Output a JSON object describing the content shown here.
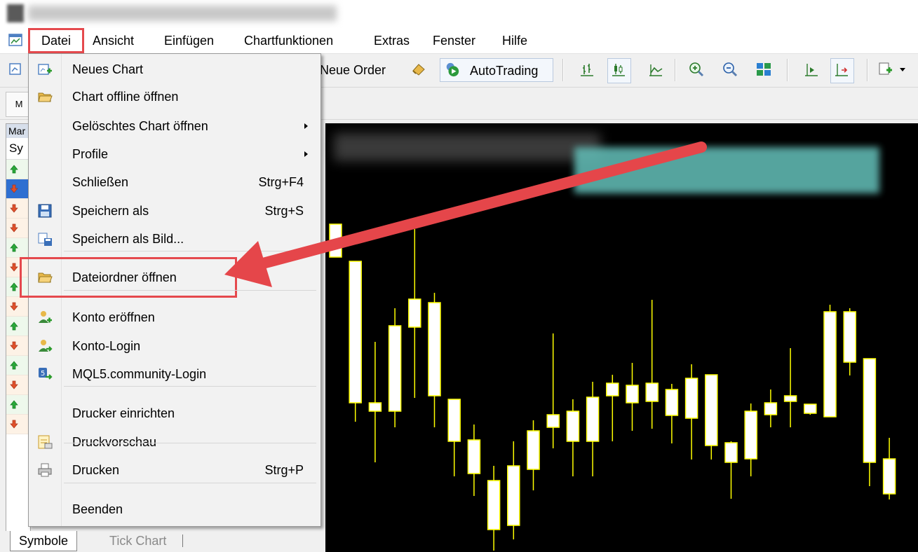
{
  "menubar": {
    "items": [
      "Datei",
      "Ansicht",
      "Einfügen",
      "Chartfunktionen",
      "Extras",
      "Fenster",
      "Hilfe"
    ]
  },
  "toolbar": {
    "neue_order": "Neue Order",
    "autotrading": "AutoTrading"
  },
  "toolbar2": {
    "button": "M"
  },
  "leftpanel": {
    "header": "Mar",
    "column": "Sy",
    "rows": [
      "up",
      "down-selected",
      "down",
      "down",
      "up",
      "down",
      "up",
      "down",
      "up",
      "down",
      "up",
      "down",
      "up",
      "down"
    ]
  },
  "file_menu": {
    "items": [
      {
        "label": "Neues Chart",
        "shortcut": "",
        "icon": "new-chart-icon"
      },
      {
        "label": "Chart offline öffnen",
        "shortcut": "",
        "icon": "open-folder-icon"
      },
      {
        "label": "Gelöschtes Chart öffnen",
        "shortcut": "",
        "icon": "",
        "submenu": true
      },
      {
        "label": "Profile",
        "shortcut": "",
        "icon": "",
        "submenu": true
      },
      {
        "label": "Schließen",
        "shortcut": "Strg+F4",
        "icon": ""
      },
      {
        "label": "Speichern als",
        "shortcut": "Strg+S",
        "icon": "floppy-disk-icon"
      },
      {
        "label": "Speichern als Bild...",
        "shortcut": "",
        "icon": "save-image-icon"
      },
      {
        "label": "Dateiordner öffnen",
        "shortcut": "",
        "icon": "folder-icon",
        "highlighted": true
      },
      {
        "label": "Konto eröffnen",
        "shortcut": "",
        "icon": "add-account-icon"
      },
      {
        "label": "Konto-Login",
        "shortcut": "",
        "icon": "account-login-icon"
      },
      {
        "label": "MQL5.community-Login",
        "shortcut": "",
        "icon": "mql5-login-icon"
      },
      {
        "label": "Drucker einrichten",
        "shortcut": "",
        "icon": ""
      },
      {
        "label": "Druckvorschau",
        "shortcut": "",
        "icon": "print-preview-icon"
      },
      {
        "label": "Drucken",
        "shortcut": "Strg+P",
        "icon": "printer-icon"
      },
      {
        "label": "Beenden",
        "shortcut": "",
        "icon": ""
      }
    ]
  },
  "bottom_tabs": [
    "Symbole",
    "Tick Chart"
  ],
  "chart": {
    "background": "#000000",
    "candle_color": "#ffff00",
    "candles": [
      {
        "o": 320,
        "c": 367,
        "h": 320,
        "l": 367
      },
      {
        "o": 373,
        "c": 575,
        "h": 373,
        "l": 602
      },
      {
        "o": 575,
        "c": 587,
        "h": 488,
        "l": 660
      },
      {
        "o": 465,
        "c": 587,
        "h": 440,
        "l": 610
      },
      {
        "o": 427,
        "c": 467,
        "h": 327,
        "l": 568
      },
      {
        "o": 432,
        "c": 565,
        "h": 418,
        "l": 610
      },
      {
        "o": 570,
        "c": 630,
        "h": 570,
        "l": 680
      },
      {
        "o": 628,
        "c": 676,
        "h": 606,
        "l": 708
      },
      {
        "o": 686,
        "c": 756,
        "h": 665,
        "l": 786
      },
      {
        "o": 665,
        "c": 750,
        "h": 630,
        "l": 770
      },
      {
        "o": 615,
        "c": 670,
        "h": 600,
        "l": 700
      },
      {
        "o": 592,
        "c": 610,
        "h": 476,
        "l": 640
      },
      {
        "o": 587,
        "c": 630,
        "h": 570,
        "l": 680
      },
      {
        "o": 567,
        "c": 630,
        "h": 545,
        "l": 680
      },
      {
        "o": 547,
        "c": 565,
        "h": 535,
        "l": 630
      },
      {
        "o": 550,
        "c": 575,
        "h": 518,
        "l": 615
      },
      {
        "o": 547,
        "c": 573,
        "h": 428,
        "l": 612
      },
      {
        "o": 556,
        "c": 593,
        "h": 548,
        "l": 633
      },
      {
        "o": 540,
        "c": 597,
        "h": 520,
        "l": 656
      },
      {
        "o": 535,
        "c": 636,
        "h": 535,
        "l": 656
      },
      {
        "o": 632,
        "c": 660,
        "h": 630,
        "l": 712
      },
      {
        "o": 587,
        "c": 655,
        "h": 576,
        "l": 680
      },
      {
        "o": 575,
        "c": 592,
        "h": 556,
        "l": 610
      },
      {
        "o": 565,
        "c": 573,
        "h": 497,
        "l": 610
      },
      {
        "o": 577,
        "c": 590,
        "h": 577,
        "l": 592
      },
      {
        "o": 445,
        "c": 595,
        "h": 435,
        "l": 595
      },
      {
        "o": 445,
        "c": 517,
        "h": 440,
        "l": 536
      },
      {
        "o": 512,
        "c": 660,
        "h": 512,
        "l": 694
      },
      {
        "o": 655,
        "c": 705,
        "h": 625,
        "l": 713
      }
    ]
  }
}
